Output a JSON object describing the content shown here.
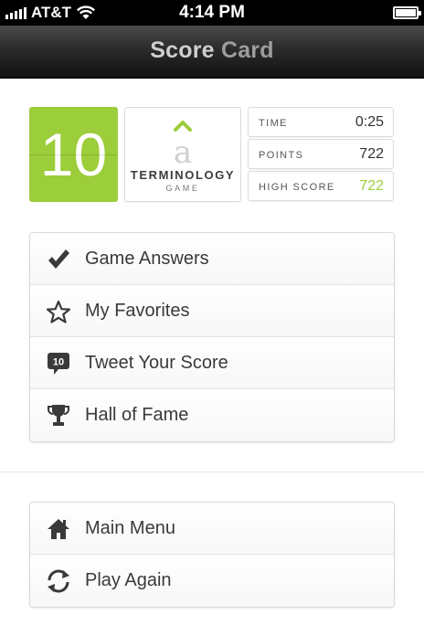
{
  "status_bar": {
    "carrier": "AT&T",
    "time": "4:14 PM"
  },
  "nav": {
    "title_word1": "Score",
    "title_word2": "Card"
  },
  "score_tile": {
    "value": "10",
    "color": "#9ccd3a"
  },
  "logo": {
    "letter": "a",
    "name": "TERMINOLOGY",
    "subtitle": "GAME"
  },
  "stats": [
    {
      "label": "TIME",
      "value": "0:25"
    },
    {
      "label": "POINTS",
      "value": "722"
    },
    {
      "label": "HIGH SCORE",
      "value": "722"
    }
  ],
  "menu": [
    {
      "label": "Game Answers",
      "icon": "checkmark-icon"
    },
    {
      "label": "My Favorites",
      "icon": "star-icon"
    },
    {
      "label": "Tweet Your Score",
      "icon": "speech-bubble-icon",
      "badge": "10"
    },
    {
      "label": "Hall of Fame",
      "icon": "trophy-icon"
    }
  ],
  "bottom_menu": [
    {
      "label": "Main Menu",
      "icon": "home-icon"
    },
    {
      "label": "Play Again",
      "icon": "refresh-icon"
    }
  ],
  "colors": {
    "accent": "#9ccd3a",
    "nav_dark": "#1c1c1c"
  }
}
